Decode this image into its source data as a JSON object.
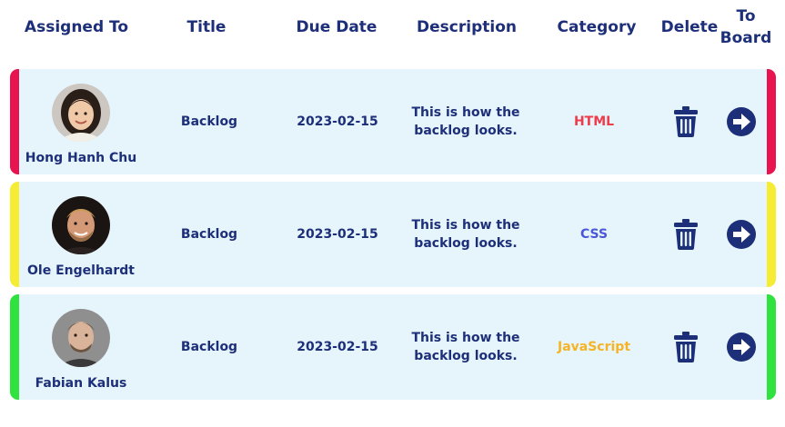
{
  "header": {
    "assigned_to": "Assigned To",
    "title": "Title",
    "due_date": "Due Date",
    "description": "Description",
    "category": "Category",
    "delete": "Delete",
    "to_board_line1": "To",
    "to_board_line2": "Board"
  },
  "rows": [
    {
      "name": "Hong Hanh Chu",
      "title": "Backlog",
      "due_date": "2023-02-15",
      "description": "This is how the backlog looks.",
      "category": "HTML",
      "category_color": "#ef3b4a",
      "accent_color": "#e8144f"
    },
    {
      "name": "Ole Engelhardt",
      "title": "Backlog",
      "due_date": "2023-02-15",
      "description": "This is how the backlog looks.",
      "category": "CSS",
      "category_color": "#4b57d8",
      "accent_color": "#f6ec34"
    },
    {
      "name": "Fabian Kalus",
      "title": "Backlog",
      "due_date": "2023-02-15",
      "description": "This is how the backlog looks.",
      "category": "JavaScript",
      "category_color": "#f5b425",
      "accent_color": "#2fe23d"
    }
  ],
  "icons": {
    "delete": "trash-icon",
    "to_board": "arrow-right-circle-icon"
  },
  "colors": {
    "text": "#1e2f7a",
    "row_background": "#e6f5fb"
  }
}
